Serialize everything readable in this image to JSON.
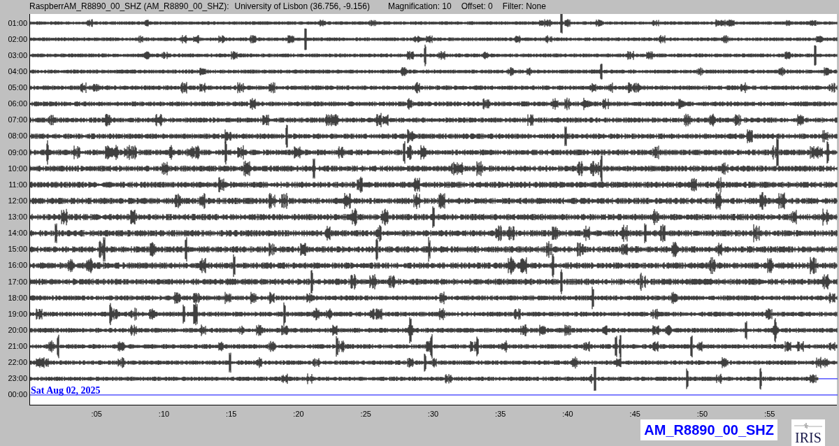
{
  "header": {
    "station": "RaspberrAM_R8890_00_SHZ (AM_R8890_00_SHZ):",
    "location": "University of Lisbon (36.756, -9.156)",
    "magnification": "Magnification: 10",
    "offset": "Offset: 0",
    "filter": "Filter: None"
  },
  "rows": [
    {
      "label": "01:00",
      "kind": "trace"
    },
    {
      "label": "02:00",
      "kind": "trace"
    },
    {
      "label": "03:00",
      "kind": "trace"
    },
    {
      "label": "04:00",
      "kind": "trace"
    },
    {
      "label": "05:00",
      "kind": "trace"
    },
    {
      "label": "06:00",
      "kind": "trace"
    },
    {
      "label": "07:00",
      "kind": "trace"
    },
    {
      "label": "08:00",
      "kind": "trace"
    },
    {
      "label": "09:00",
      "kind": "trace"
    },
    {
      "label": "10:00",
      "kind": "trace"
    },
    {
      "label": "11:00",
      "kind": "trace"
    },
    {
      "label": "12:00",
      "kind": "trace"
    },
    {
      "label": "13:00",
      "kind": "trace"
    },
    {
      "label": "14:00",
      "kind": "trace"
    },
    {
      "label": "15:00",
      "kind": "trace"
    },
    {
      "label": "16:00",
      "kind": "trace"
    },
    {
      "label": "17:00",
      "kind": "trace"
    },
    {
      "label": "18:00",
      "kind": "trace"
    },
    {
      "label": "19:00",
      "kind": "trace"
    },
    {
      "label": "20:00",
      "kind": "trace"
    },
    {
      "label": "21:00",
      "kind": "trace"
    },
    {
      "label": "22:00",
      "kind": "trace"
    },
    {
      "label": "23:00",
      "kind": "partial"
    },
    {
      "label": "00:00",
      "kind": "current"
    }
  ],
  "date_label": "Sat Aug 02, 2025",
  "x_ticks": [
    ":05",
    ":10",
    ":15",
    ":20",
    ":25",
    ":30",
    ":35",
    ":40",
    ":45",
    ":50",
    ":55"
  ],
  "station_badge": "AM_R8890_00_SHZ",
  "logo": "IRIS"
}
